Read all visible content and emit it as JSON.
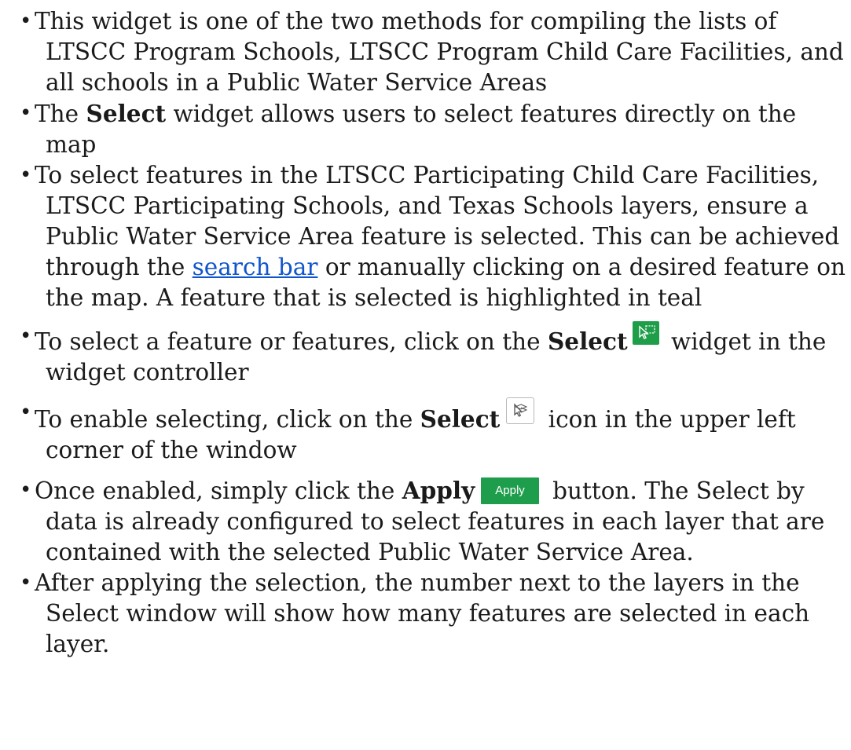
{
  "bullets": [
    {
      "text": "This widget is one of the two methods for compiling the lists of LTSCC Program Schools, LTSCC Program Child Care Facilities, and all schools in a Public Water Service Areas"
    },
    {
      "before": "The ",
      "bold": "Select",
      "after": " widget allows users to select features directly on the map"
    },
    {
      "before": "To select features in the LTSCC Participating Child Care Facilities, LTSCC Participating Schools, and Texas Schools layers, ensure a Public Water Service Area feature is selected. This can be achieved through the ",
      "link": "search bar",
      "after": " or manually clicking on a desired feature on the map. A feature that is selected is highlighted in teal"
    },
    {
      "before": "To select a feature or features, click on the ",
      "bold": "Select",
      "after": " widget in the widget controller"
    },
    {
      "before": "To enable selecting, click on the ",
      "bold": "Select",
      "after": " icon in the upper left corner of the window"
    },
    {
      "before": "Once enabled, simply click the ",
      "bold": "Apply",
      "button_label": "Apply",
      "after": " button. The Select by data is already configured to select features in each layer that are contained with the selected Public Water Service Area."
    },
    {
      "text": "After applying the selection, the number next to the layers in the Select window will show how many features are selected in each layer."
    }
  ],
  "icons": {
    "select_widget": "select-widget-icon",
    "select_tool": "select-tool-icon"
  },
  "colors": {
    "widget_green": "#1f9e4a",
    "apply_green": "#1e9e4d",
    "link_blue": "#1155cc"
  }
}
